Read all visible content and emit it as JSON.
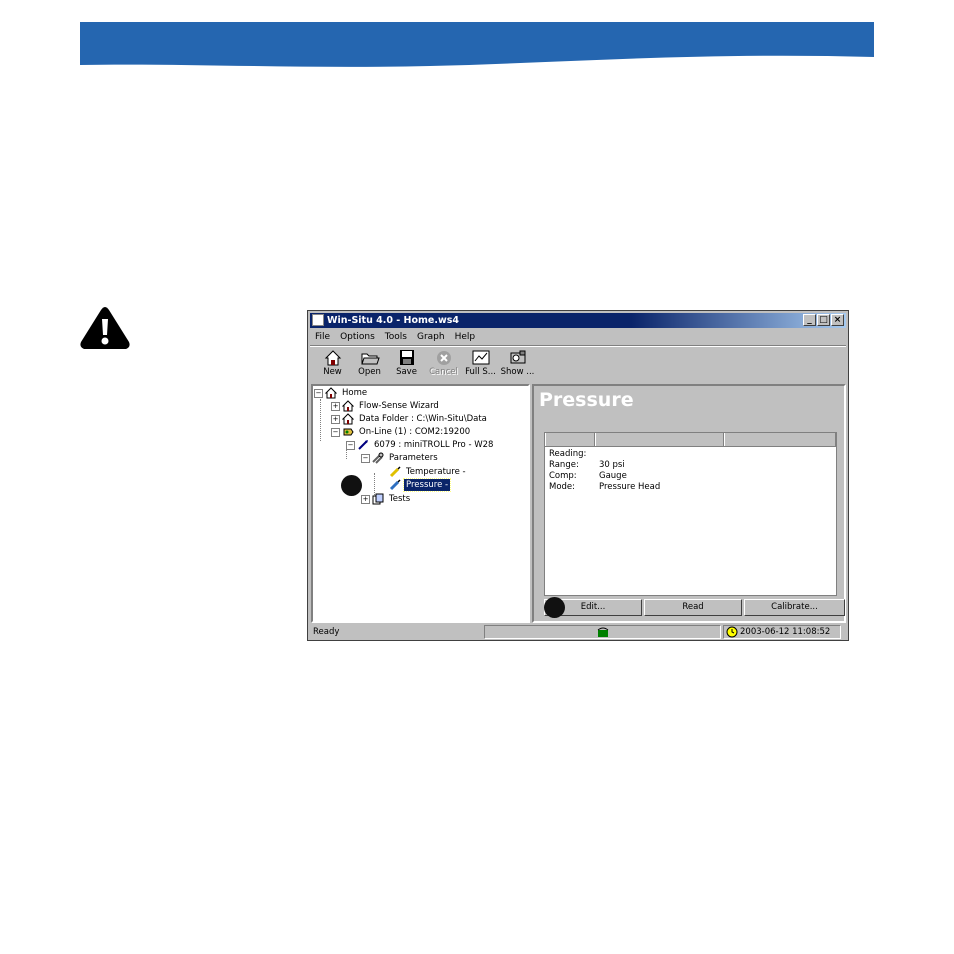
{
  "colors": {
    "banner_blue": "#2566b0",
    "title_bar": "#0a246a",
    "selection": "#0a246a"
  },
  "window": {
    "title": "Win-Situ 4.0 - Home.ws4",
    "buttons": {
      "minimize_icon": "minimize-icon",
      "maximize_icon": "maximize-icon",
      "close_icon": "close-icon"
    }
  },
  "menu": [
    "File",
    "Options",
    "Tools",
    "Graph",
    "Help"
  ],
  "toolbar": [
    {
      "label": "New",
      "icon": "new-icon",
      "enabled": true
    },
    {
      "label": "Open",
      "icon": "open-folder-icon",
      "enabled": true
    },
    {
      "label": "Save",
      "icon": "save-icon",
      "enabled": true
    },
    {
      "label": "Cancel",
      "icon": "cancel-icon",
      "enabled": false
    },
    {
      "label": "Full S...",
      "icon": "full-screen-icon",
      "enabled": true
    },
    {
      "label": "Show ...",
      "icon": "show-icon",
      "enabled": true
    }
  ],
  "tree": {
    "home": "Home",
    "flow_sense": "Flow-Sense Wizard",
    "data_folder": "Data Folder : C:\\Win-Situ\\Data",
    "online": "On-Line (1) : COM2:19200",
    "device": "6079 : miniTROLL Pro - W28",
    "parameters": "Parameters",
    "temperature": "Temperature -",
    "pressure": "Pressure -",
    "tests": "Tests"
  },
  "panel": {
    "title": "Pressure",
    "rows": [
      {
        "key": "Reading:",
        "value": ""
      },
      {
        "key": "Range:",
        "value": "30 psi"
      },
      {
        "key": "Comp:",
        "value": "Gauge"
      },
      {
        "key": "Mode:",
        "value": "Pressure Head"
      }
    ],
    "buttons": [
      "Edit...",
      "Read",
      "Calibrate..."
    ]
  },
  "status": {
    "ready": "Ready",
    "datetime": "2003-06-12 11:08:52",
    "phone_icon": "phone-icon",
    "clock_icon": "clock-icon"
  }
}
